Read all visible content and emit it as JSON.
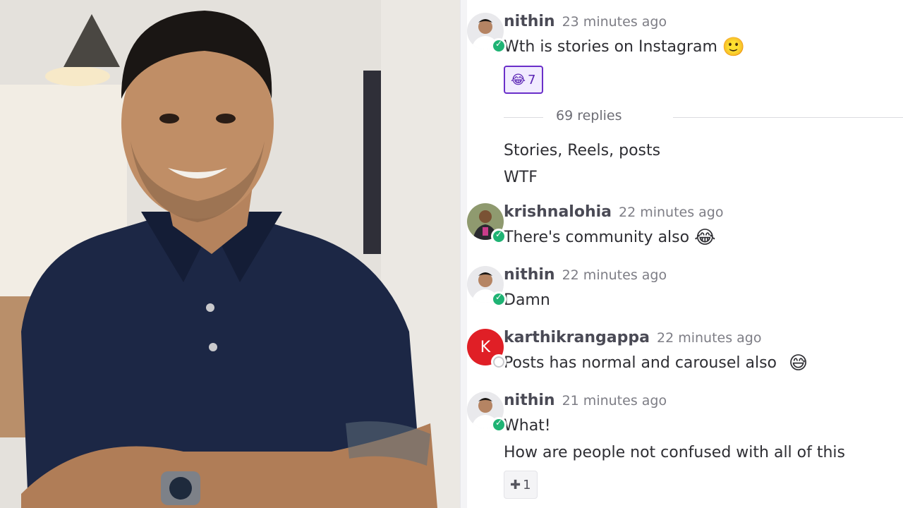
{
  "messages": [
    {
      "user": "nithin",
      "time": "23 minutes ago",
      "lines": [
        "Wth is stories on Instagram"
      ],
      "emoji": "🙂",
      "reaction": {
        "emoji": "😂",
        "count": "7"
      }
    },
    {
      "user": "krishnalohia",
      "time": "22 minutes ago",
      "lines": [
        "There's community also"
      ],
      "emoji": "😂"
    },
    {
      "user": "nithin",
      "time": "22 minutes ago",
      "lines": [
        "Damn"
      ]
    },
    {
      "user": "karthikrangappa",
      "time": "22 minutes ago",
      "lines": [
        "Posts has normal and carousel also"
      ],
      "emoji": "😅",
      "avatar_letter": "K"
    },
    {
      "user": "nithin",
      "time": "21 minutes ago",
      "lines": [
        "What!",
        "How are people not confused with all of this"
      ],
      "reaction": {
        "emoji": "✚",
        "count": "1"
      }
    }
  ],
  "thread": {
    "replies_label": "69 replies",
    "lines": [
      "Stories, Reels, posts",
      "WTF"
    ]
  },
  "colors": {
    "online": "#1fb374",
    "accent": "#6a2fc9",
    "avatar_k": "#e01f26"
  }
}
